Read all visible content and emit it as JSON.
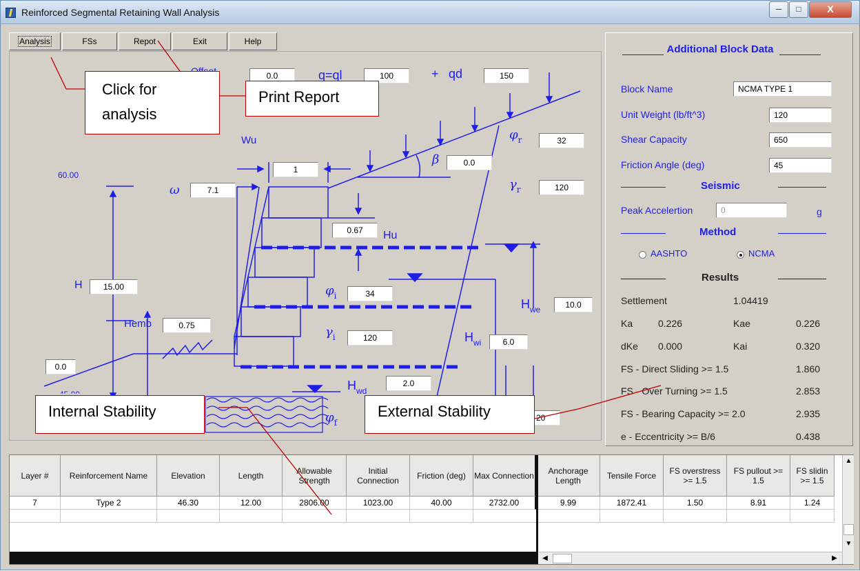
{
  "window": {
    "title": "Reinforced Segmental Retaining Wall Analysis",
    "min": "─",
    "max": "□",
    "close": "X"
  },
  "menu": [
    "Analysis",
    "FSs",
    "Repot",
    "Exit",
    "Help"
  ],
  "diagram": {
    "offset_label": "Offset",
    "offset": "0.0",
    "q_label": "q=ql",
    "q": "100",
    "plus": "+",
    "qd_label": "qd",
    "qd": "150",
    "phi_r": "32",
    "gamma_r": "120",
    "beta": "0.0",
    "wu_label": "Wu",
    "wu": "1",
    "top_label": "60.00",
    "omega": "7.1",
    "hu": "0.67",
    "hu_label": "Hu",
    "h_label": "H",
    "h": "15.00",
    "phi_i": "34",
    "gamma_i": "120",
    "hwe_label": "H",
    "hwe_sub": "we",
    "hwe": "10.0",
    "hemb_label": "Hemb",
    "hemb": "0.75",
    "hwi_label": "H",
    "hwi_sub": "wi",
    "hwi": "6.0",
    "toe": "0.0",
    "toe_elev": "45.00",
    "hwd_label": "H",
    "hwd_sub": "wd",
    "hwd": "2.0",
    "phi_f_partial": "20",
    "sym_phi": "φ",
    "sym_gamma": "γ",
    "sym_beta": "β",
    "sym_omega": "ω",
    "sub_r": "r",
    "sub_i": "i",
    "sub_f": "f"
  },
  "right": {
    "heading": "Additional Block Data",
    "block_name_label": "Block Name",
    "block_name": "NCMA TYPE 1",
    "unit_weight_label": "Unit Weight (lb/ft^3)",
    "unit_weight": "120",
    "shear_label": "Shear Capacity",
    "shear": "650",
    "friction_label": "Friction Angle (deg)",
    "friction": "45",
    "seismic_heading": "Seismic",
    "peak_label": "Peak Accelertion",
    "peak": "0",
    "peak_unit": "g",
    "method_heading": "Method",
    "aashto": "AASHTO",
    "ncma": "NCMA",
    "results_heading": "Results",
    "settlement_label": "Settlement",
    "settlement": "1.04419",
    "ka_label": "Ka",
    "ka": "0.226",
    "kae_label": "Kae",
    "kae": "0.226",
    "dke_label": "dKe",
    "dke": "0.000",
    "kai_label": "Kai",
    "kai": "0.320",
    "fs1_label": "FS - Direct Sliding >= 1.5",
    "fs1": "1.860",
    "fs2_label": "FS - Over Turning >= 1.5",
    "fs2": "2.853",
    "fs3_label": "FS - Bearing Capacity >= 2.0",
    "fs3": "2.935",
    "fs4_label": "e - Eccentricity >= B/6",
    "fs4": "0.438"
  },
  "callouts": {
    "analysis": "Click for analysis",
    "report": "Print Report",
    "internal": "Internal Stability",
    "external": "External Stability"
  },
  "table": {
    "headers": [
      "Layer #",
      "Reinforcement Name",
      "Elevation",
      "Length",
      "Allowable Strength",
      "Initial Connection",
      "Friction (deg)",
      "Max Connection",
      "Anchorage Length",
      "Tensile Force",
      "FS overstress >= 1.5",
      "FS pullout >= 1.5",
      "FS slidin >= 1.5"
    ],
    "row": [
      "7",
      "Type 2",
      "46.30",
      "12.00",
      "2806.00",
      "1023.00",
      "40.00",
      "2732.00",
      "9.99",
      "1872.41",
      "1.50",
      "8.91",
      "1.24"
    ]
  },
  "colors": {
    "blue": "#1e1ee8",
    "callout_border": "#c00000"
  }
}
